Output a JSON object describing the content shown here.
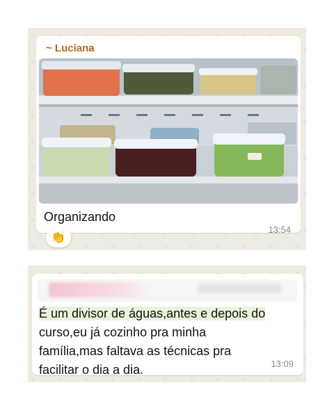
{
  "message_1": {
    "sender": "~ Luciana",
    "caption": "Organizando",
    "time": "13:54",
    "reaction": "👏"
  },
  "message_2": {
    "text_line_1": "É um divisor de águas,antes e depois do",
    "text_line_2": "curso,eu já cozinho pra minha",
    "text_line_3": "família,mas faltava as técnicas pra",
    "text_line_4": "facilitar o dia a dia.",
    "time": "13:09"
  },
  "colors": {
    "chat_background": "#efeae2",
    "sender_name": "#b5651d",
    "text_highlight": "#e9f2db"
  }
}
